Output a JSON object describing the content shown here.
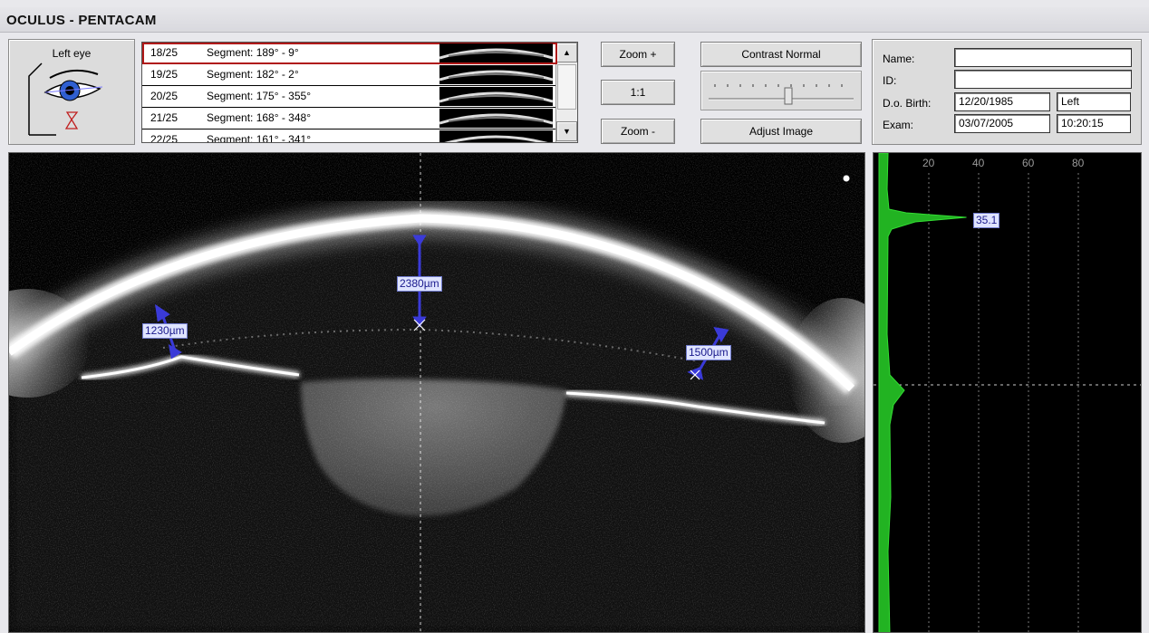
{
  "app": {
    "title": "OCULUS - PENTACAM"
  },
  "eye": {
    "label": "Left eye"
  },
  "segments": [
    {
      "num": "18/25",
      "label": "Segment: 189° - 9°",
      "selected": true
    },
    {
      "num": "19/25",
      "label": "Segment: 182° - 2°"
    },
    {
      "num": "20/25",
      "label": "Segment: 175° - 355°"
    },
    {
      "num": "21/25",
      "label": "Segment: 168° - 348°"
    },
    {
      "num": "22/25",
      "label": "Segment: 161° - 341°"
    }
  ],
  "zoom": {
    "zoom_in": "Zoom +",
    "reset": "1:1",
    "zoom_out": "Zoom -"
  },
  "image": {
    "contrast": "Contrast Normal",
    "adjust": "Adjust Image"
  },
  "patient": {
    "name_label": "Name:",
    "name": "",
    "id_label": "ID:",
    "id": "",
    "dob_label": "D.o. Birth:",
    "dob": "12/20/1985",
    "eye": "Left",
    "exam_label": "Exam:",
    "exam_date": "03/07/2005",
    "exam_time": "10:20:15"
  },
  "measurements": [
    {
      "label": "1230µm"
    },
    {
      "label": "2380µm"
    },
    {
      "label": "1500µm"
    }
  ],
  "chart_data": {
    "type": "area",
    "x_ticks": [
      "20",
      "40",
      "60",
      "80"
    ],
    "xlim": [
      0,
      100
    ],
    "grid": true,
    "peak_label": "35.1",
    "peak_value": 35.1,
    "series_color": "#22b322"
  }
}
